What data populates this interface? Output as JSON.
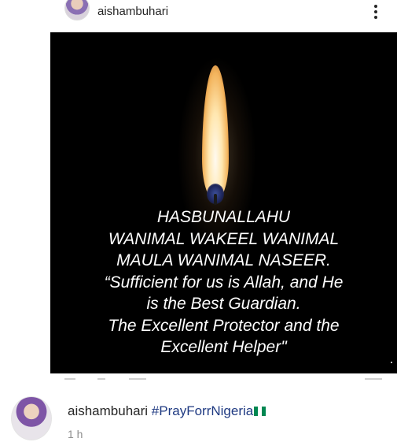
{
  "post": {
    "username": "aishambuhari",
    "more_icon": "more-vertical-icon",
    "image": {
      "quote_lines": [
        "HASBUNALLAHU",
        "WANIMAL WAKEEL WANIMAL",
        "MAULA WANIMAL NASEER.",
        "“Sufficient for us is Allah, and He",
        "is the Best Guardian.",
        "The Excellent Protector and the",
        "Excellent Helper\""
      ]
    },
    "caption": {
      "username": "aishambuhari",
      "hashtag": "#PrayForrNigeria",
      "flag_icon": "nigeria-flag-icon",
      "flag_colors": [
        "#008751",
        "#ffffff",
        "#008751"
      ]
    },
    "time": "1 h"
  }
}
